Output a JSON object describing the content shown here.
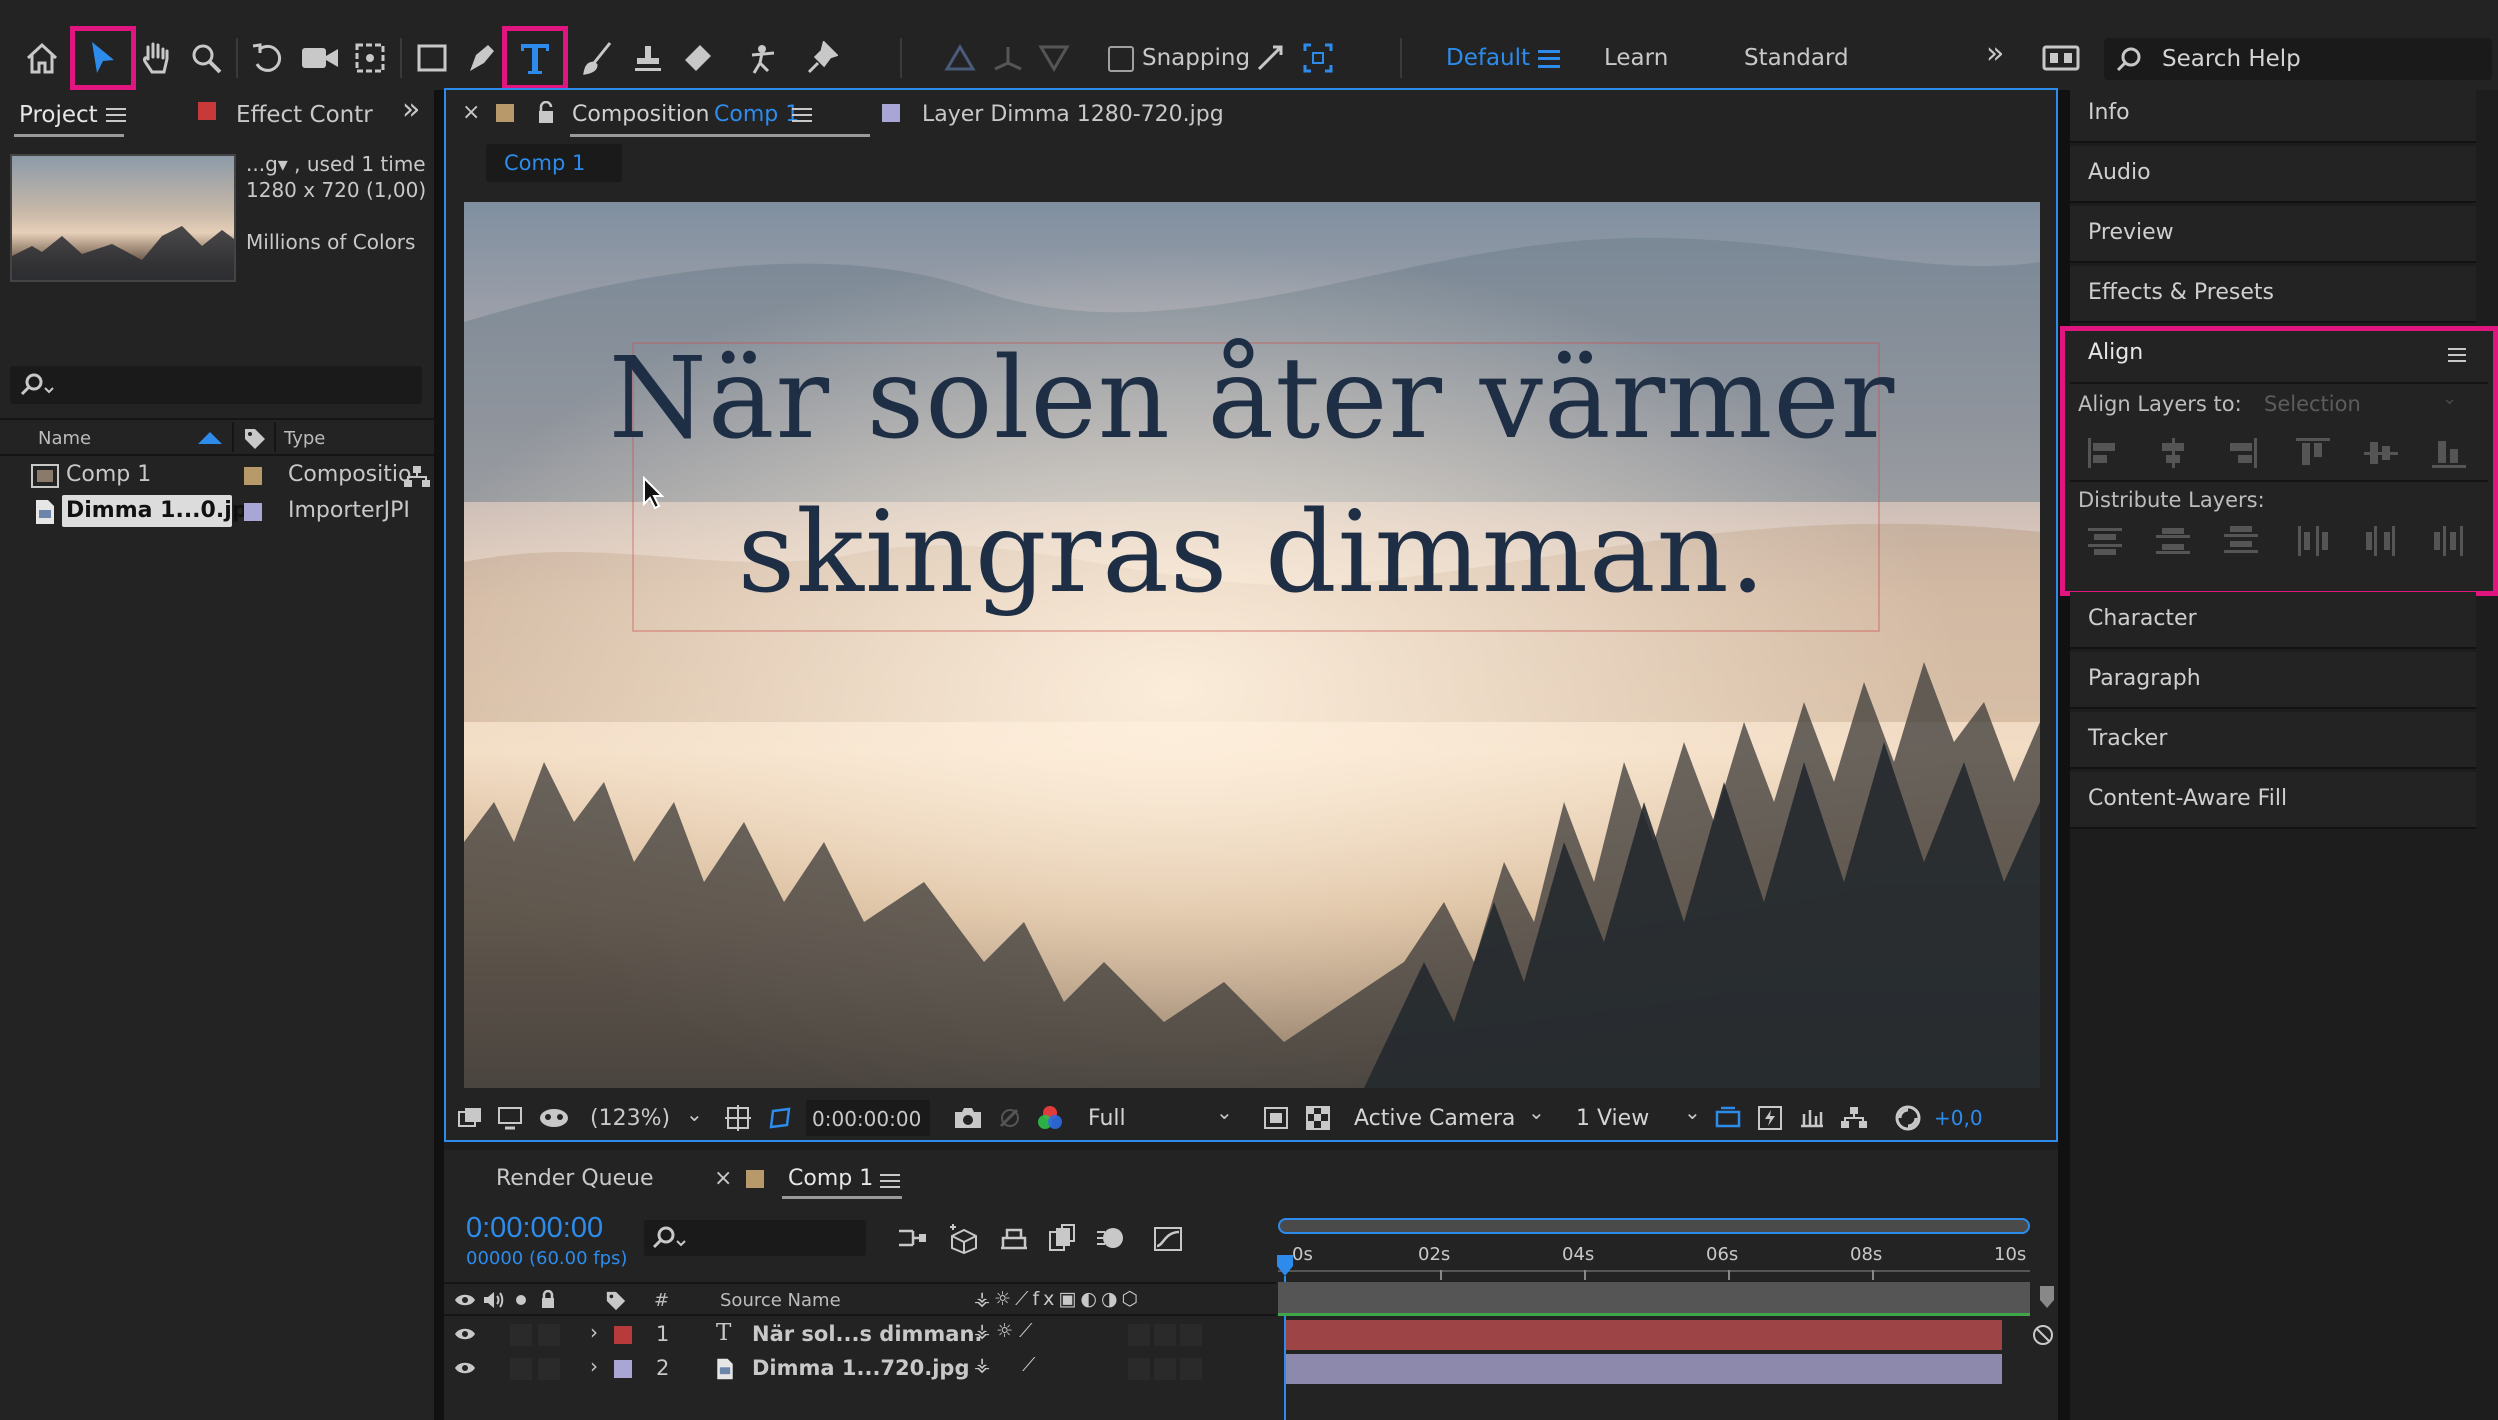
{
  "toolbar": {
    "snapping_label": "Snapping",
    "workspaces": [
      "Default",
      "Learn",
      "Standard"
    ],
    "search_placeholder": "Search Help"
  },
  "project_panel": {
    "tab_project": "Project",
    "tab_effects": "Effect Contr",
    "preview_info": {
      "line1": "...g▾ , used 1 time",
      "line2": "1280 x 720 (1,00)",
      "line3": "Millions of Colors"
    },
    "columns": {
      "name": "Name",
      "type": "Type"
    },
    "items": [
      {
        "name": "Comp 1",
        "type": "Compositio",
        "color": "#b89a6a"
      },
      {
        "name": "Dimma 1...0.jpg",
        "type": "ImporterJPI",
        "color": "#a9a6d6"
      }
    ]
  },
  "comp_panel": {
    "tab_composition_prefix": "Composition",
    "tab_composition_name": "Comp 1",
    "tab_layer": "Layer Dimma 1280-720.jpg",
    "breadcrumb": "Comp 1",
    "canvas_text_line1": "När solen åter värmer",
    "canvas_text_line2": "skingras dimman.",
    "footer": {
      "zoom": "(123%)",
      "timecode": "0:00:00:00",
      "resolution": "Full",
      "camera": "Active Camera",
      "views": "1 View",
      "exposure": "+0,0"
    }
  },
  "right_panel": {
    "items_top": [
      "Info",
      "Audio",
      "Preview",
      "Effects & Presets"
    ],
    "align": {
      "title": "Align",
      "align_to_label": "Align Layers to:",
      "align_to_value": "Selection",
      "distribute_label": "Distribute Layers:"
    },
    "items_bottom": [
      "Character",
      "Paragraph",
      "Tracker",
      "Content-Aware Fill"
    ]
  },
  "timeline": {
    "tab_render": "Render Queue",
    "tab_comp": "Comp 1",
    "timecode": "0:00:00:00",
    "fps": "00000 (60.00 fps)",
    "col_number": "#",
    "col_source": "Source Name",
    "ruler": [
      "0s",
      "02s",
      "04s",
      "06s",
      "08s",
      "10s"
    ],
    "layers": [
      {
        "num": "1",
        "type_icon": "T",
        "name": "När sol...s dimman.",
        "color": "#b83a3a",
        "bar": "#9c4446"
      },
      {
        "num": "2",
        "type_icon": "image-file-icon",
        "name": "Dimma 1...720.jpg",
        "color": "#a9a6d6",
        "bar": "#8d89ad"
      }
    ]
  },
  "colors": {
    "accent": "#2d8ceb",
    "highlight": "#e0157f"
  }
}
